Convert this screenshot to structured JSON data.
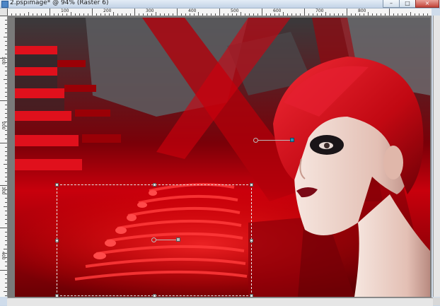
{
  "window": {
    "title": "2.pspimage* @  94% (Raster 6)",
    "buttons": {
      "minimize": "–",
      "maximize": "□",
      "close": "×"
    }
  },
  "ruler": {
    "h_labels": [
      "100",
      "200",
      "300",
      "400",
      "500",
      "600",
      "700",
      "800"
    ],
    "v_labels": [
      "100",
      "200",
      "300",
      "400"
    ]
  },
  "canvas": {
    "layer": "Raster 6",
    "zoom": "94%"
  },
  "colors": {
    "accent_red": "#c8000c",
    "dark_red": "#5a0004",
    "hair_red": "#d0101c",
    "skin": "#ecd4cb",
    "rotation_handle": "#2a8fb4"
  }
}
